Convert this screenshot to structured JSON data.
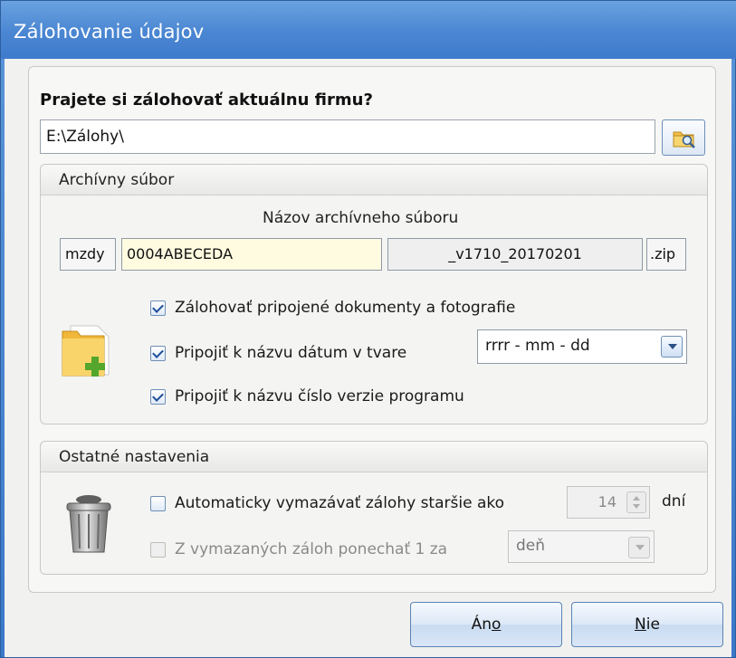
{
  "window": {
    "title": "Zálohovanie údajov"
  },
  "prompt": {
    "question": "Prajete si zálohovať aktuálnu firmu?"
  },
  "path": {
    "value": "E:\\Zálohy\\",
    "browse_icon": "folder-search-icon"
  },
  "archive": {
    "group_title": "Archívny súbor",
    "name_label": "Názov archívneho súboru",
    "prefix": "mzdy",
    "company_code": "0004ABECEDA",
    "suffix": "_v1710_20170201",
    "extension": ".zip",
    "icon": "folder-add-icon",
    "options": [
      {
        "label": "Zálohovať pripojené dokumenty a fotografie",
        "checked": true
      },
      {
        "label": "Pripojiť k názvu dátum v tvare",
        "checked": true
      },
      {
        "label": "Pripojiť k názvu číslo verzie programu",
        "checked": true
      }
    ],
    "date_format": "rrrr - mm - dd"
  },
  "other": {
    "group_title": "Ostatné nastavenia",
    "icon": "trash-bin-icon",
    "auto_delete": {
      "label": "Automaticky vymazávať zálohy staršie ako",
      "checked": false,
      "days": "14",
      "unit": "dní"
    },
    "keep_one": {
      "label": "Z vymazaných záloh ponechať 1 za",
      "checked": false,
      "enabled": false,
      "period": "deň"
    }
  },
  "buttons": {
    "yes_pre": "Án",
    "yes_key": "o",
    "no_key": "N",
    "no_post": "ie"
  },
  "colors": {
    "titlebar": "#4a86d2",
    "highlight_input": "#fffbe0",
    "accent": "#1f4f9a"
  }
}
